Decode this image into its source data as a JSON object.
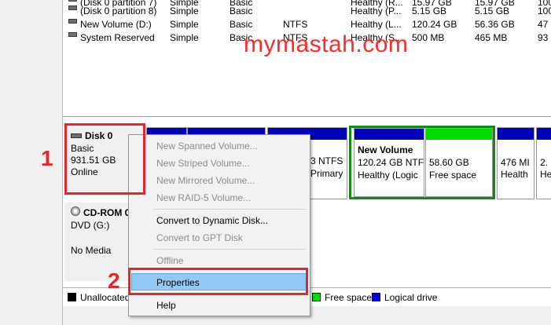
{
  "volumes": [
    {
      "name": "(Disk 0 partition 7)",
      "layout": "Simple",
      "type": "Basic",
      "fs": "",
      "status": "Healthy (R...",
      "capacity": "15.97 GB",
      "free": "15.97 GB",
      "pct": "100"
    },
    {
      "name": "(Disk 0 partition 8)",
      "layout": "Simple",
      "type": "Basic",
      "fs": "",
      "status": "Healthy (P...",
      "capacity": "5.15 GB",
      "free": "5.15 GB",
      "pct": "100"
    },
    {
      "name": "New Volume (D:)",
      "layout": "Simple",
      "type": "Basic",
      "fs": "NTFS",
      "status": "Healthy (L...",
      "capacity": "120.24 GB",
      "free": "56.36 GB",
      "pct": "47"
    },
    {
      "name": "System Reserved",
      "layout": "Simple",
      "type": "Basic",
      "fs": "NTFS",
      "status": "Healthy (S...",
      "capacity": "500 MB",
      "free": "465 MB",
      "pct": "93"
    }
  ],
  "watermark": "mymastah.com",
  "disk0": {
    "name": "Disk 0",
    "type": "Basic",
    "size": "931.51 GB",
    "state": "Online"
  },
  "partitions": {
    "p_ntfs": {
      "line1": "3 NTFS",
      "line2": "Primary"
    },
    "new_volume": {
      "title": "New Volume",
      "line1": "120.24 GB NTF",
      "line2": "Healthy (Logic"
    },
    "free_space": {
      "size": "58.60 GB",
      "label": "Free space"
    },
    "p476": {
      "line1": "476 MI",
      "line2": "Health"
    },
    "p_last": {
      "line1": "2.",
      "line2": "He"
    }
  },
  "cdrom": {
    "name": "CD-ROM 0",
    "drive": "DVD (G:)",
    "media": "No Media"
  },
  "legend": {
    "unallocated": "Unallocated",
    "free": "Free space",
    "logical": "Logical drive"
  },
  "menu": {
    "items": [
      {
        "label": "New Spanned Volume...",
        "enabled": false
      },
      {
        "label": "New Striped Volume...",
        "enabled": false
      },
      {
        "label": "New Mirrored Volume...",
        "enabled": false
      },
      {
        "label": "New RAID-5 Volume...",
        "enabled": false
      },
      {
        "label": "Convert to Dynamic Disk...",
        "enabled": true
      },
      {
        "label": "Convert to GPT Disk",
        "enabled": false
      },
      {
        "label": "Offline",
        "enabled": false
      },
      {
        "label": "Properties",
        "enabled": true
      },
      {
        "label": "Help",
        "enabled": true
      }
    ]
  },
  "annotations": {
    "step1": "1",
    "step2": "2"
  },
  "colors": {
    "primary_bar": "#0000b8",
    "free_bar": "#00dd00",
    "annotation": "#e8242c",
    "highlight": "#91c9f7",
    "new_volume_border": "#138a13"
  }
}
